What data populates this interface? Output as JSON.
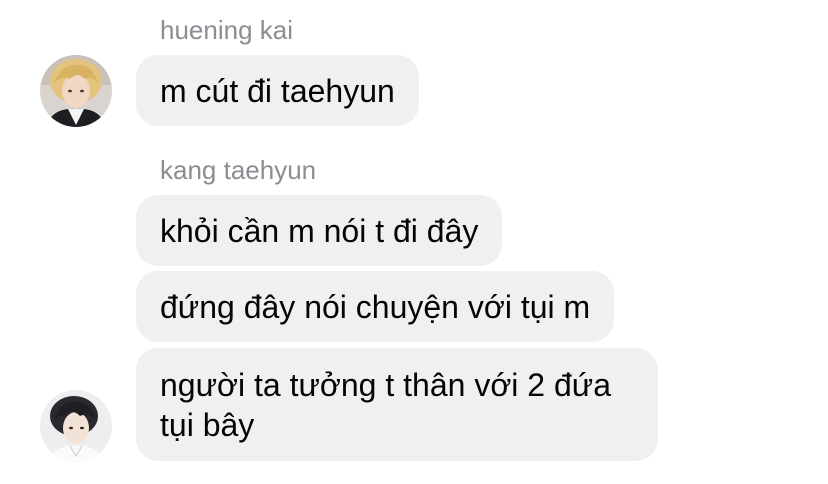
{
  "conversation": {
    "groups": [
      {
        "sender": "huening kai",
        "avatar_icon": "profile-photo-blond-hair",
        "messages": [
          "m cút đi taehyun"
        ]
      },
      {
        "sender": "kang taehyun",
        "avatar_icon": "profile-photo-dark-hair",
        "messages": [
          "khỏi cần m nói t đi đây",
          "đứng đây nói chuyện với tụi m",
          "người ta tưởng t thân với 2 đứa tụi bây"
        ]
      }
    ]
  },
  "colors": {
    "bubble_bg": "#f0f0f0",
    "name_text": "#8a8d91",
    "message_text": "#050505",
    "background": "#ffffff"
  }
}
